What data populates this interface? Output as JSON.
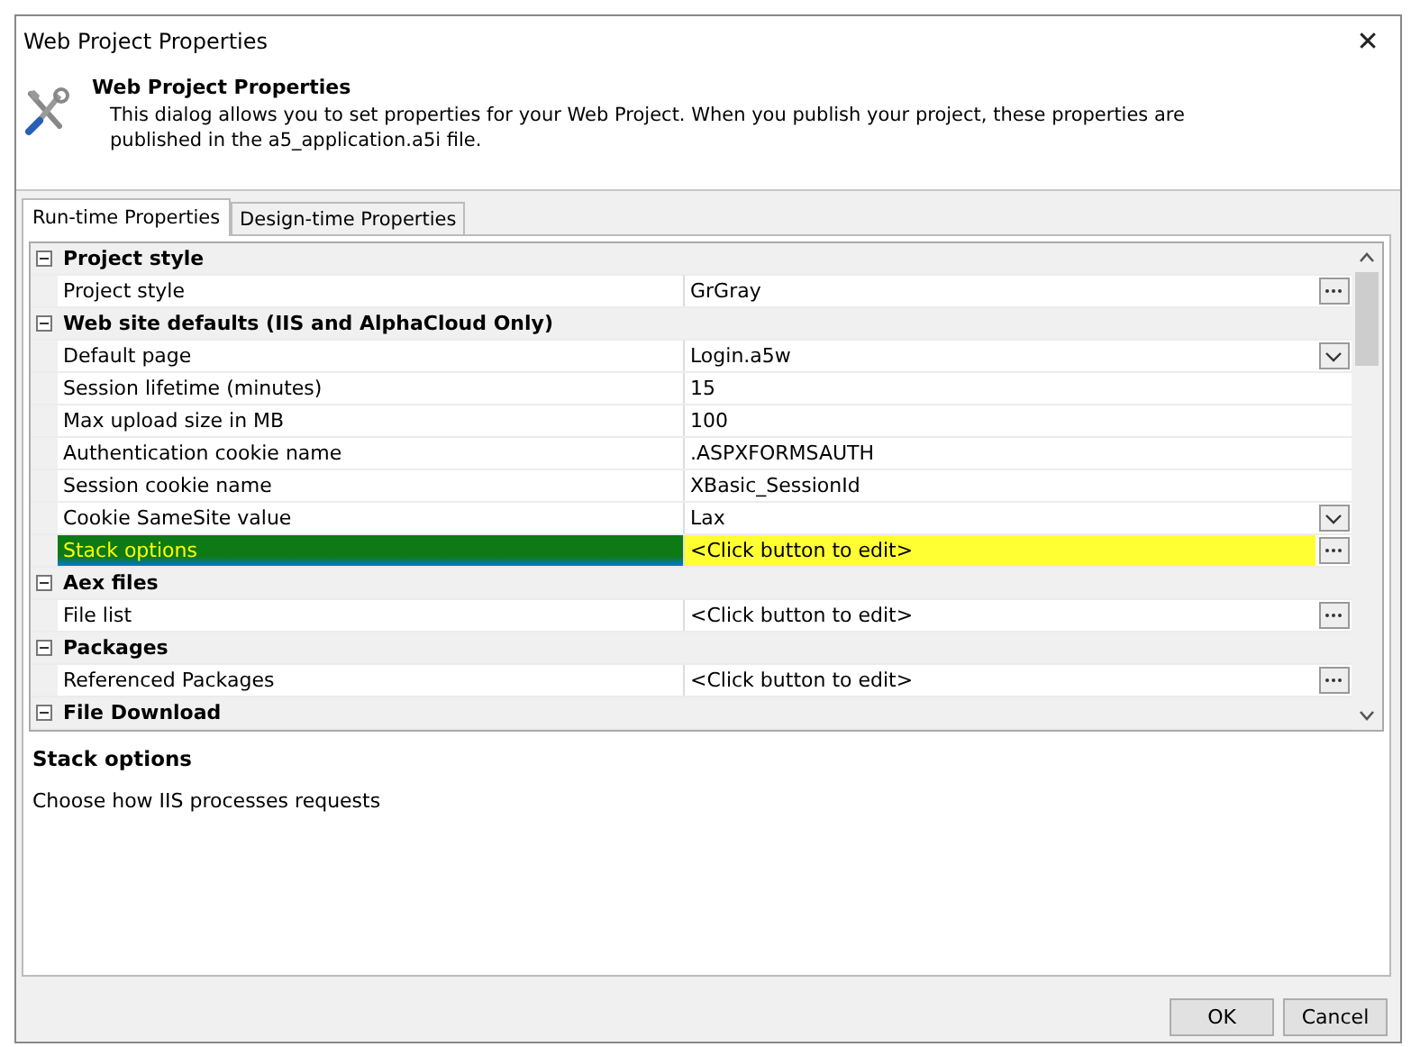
{
  "window": {
    "title": "Web Project Properties",
    "close": "✕"
  },
  "header": {
    "title": "Web Project Properties",
    "description": "This dialog allows you to set properties for your Web Project. When you publish your project, these properties are published in the a5_application.a5i file."
  },
  "tabs": [
    {
      "label": "Run-time Properties",
      "selected": true
    },
    {
      "label": "Design-time Properties",
      "selected": false
    }
  ],
  "grid": {
    "rows": [
      {
        "kind": "category",
        "label": "Project style",
        "expanded": true
      },
      {
        "kind": "ellipsis",
        "label": "Project style",
        "value": "GrGray",
        "selected": false
      },
      {
        "kind": "category",
        "label": "Web site defaults (IIS and AlphaCloud Only)",
        "expanded": true
      },
      {
        "kind": "dropdown",
        "label": "Default page",
        "value": "Login.a5w",
        "selected": false
      },
      {
        "kind": "text",
        "label": "Session lifetime (minutes)",
        "value": "15",
        "selected": false
      },
      {
        "kind": "text",
        "label": "Max upload size in MB",
        "value": "100",
        "selected": false
      },
      {
        "kind": "text",
        "label": "Authentication cookie name",
        "value": ".ASPXFORMSAUTH",
        "selected": false
      },
      {
        "kind": "text",
        "label": "Session cookie name",
        "value": "XBasic_SessionId",
        "selected": false
      },
      {
        "kind": "dropdown",
        "label": "Cookie SameSite value",
        "value": "Lax",
        "selected": false
      },
      {
        "kind": "ellipsis",
        "label": "Stack options",
        "value": "<Click button to edit>",
        "selected": true
      },
      {
        "kind": "category",
        "label": "Aex files",
        "expanded": true
      },
      {
        "kind": "ellipsis",
        "label": "File list",
        "value": "<Click button to edit>",
        "selected": false
      },
      {
        "kind": "category",
        "label": "Packages",
        "expanded": true
      },
      {
        "kind": "ellipsis",
        "label": "Referenced Packages",
        "value": "<Click button to edit>",
        "selected": false
      },
      {
        "kind": "category",
        "label": "File Download",
        "expanded": true
      }
    ]
  },
  "help": {
    "title": "Stack options",
    "text": "Choose how IIS processes requests"
  },
  "buttons": [
    {
      "label": "OK"
    },
    {
      "label": "Cancel"
    }
  ]
}
